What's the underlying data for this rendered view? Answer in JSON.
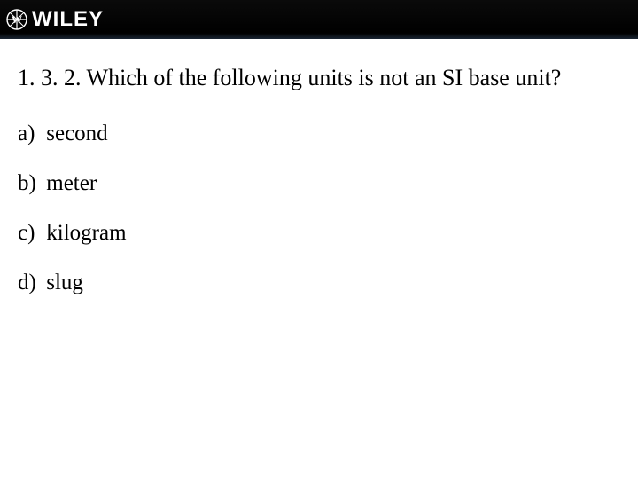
{
  "header": {
    "brand_text": "WILEY",
    "brand_icon": "wiley-logo-icon"
  },
  "question": {
    "number": "1. 3. 2.",
    "text": "Which of the following units is not an SI base unit?"
  },
  "options": [
    {
      "letter": "a)",
      "text": "second"
    },
    {
      "letter": "b)",
      "text": "meter"
    },
    {
      "letter": "c)",
      "text": "kilogram"
    },
    {
      "letter": "d)",
      "text": "slug"
    }
  ]
}
